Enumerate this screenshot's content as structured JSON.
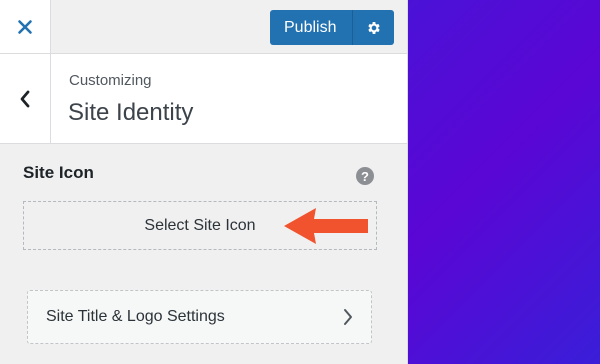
{
  "header": {
    "close_icon": "close-icon",
    "publish_label": "Publish",
    "settings_icon": "gear-icon",
    "accent_color": "#2271b1"
  },
  "section": {
    "back_icon": "chevron-left-icon",
    "context_label": "Customizing",
    "title": "Site Identity"
  },
  "site_icon_control": {
    "title": "Site Icon",
    "help_icon": "help-icon",
    "help_glyph": "?",
    "select_button_label": "Select Site Icon",
    "annotation": "red-arrow-icon",
    "annotation_color": "#f0532d"
  },
  "nav": {
    "item_label": "Site Title & Logo Settings",
    "item_icon": "chevron-right-icon"
  },
  "preview": {
    "background_color": "#4b12d6"
  }
}
